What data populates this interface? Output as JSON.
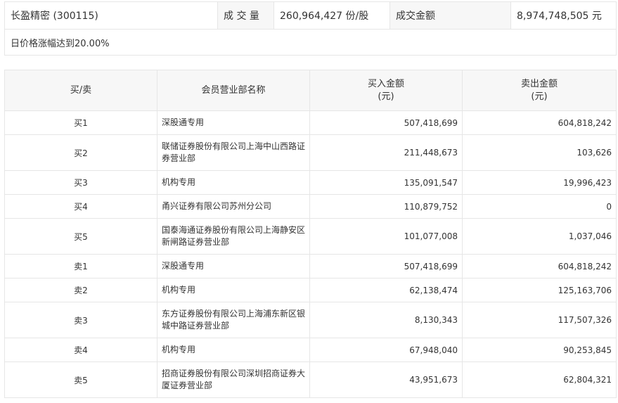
{
  "info": {
    "stock": "长盈精密 (300115)",
    "volume_label": "成 交 量",
    "volume_value": "260,964,427 份/股",
    "amount_label": "成交金额",
    "amount_value": "8,974,748,505 元",
    "reason": "日价格涨幅达到20.00%"
  },
  "table": {
    "headers": {
      "side": "买/卖",
      "dept": "会员营业部名称",
      "buy": "买入金额",
      "buy_unit": "(元)",
      "sell": "卖出金额",
      "sell_unit": "(元)"
    },
    "rows": [
      {
        "side": "买1",
        "name": "深股通专用",
        "buy": "507,418,699",
        "sell": "604,818,242"
      },
      {
        "side": "买2",
        "name": "联储证券股份有限公司上海中山西路证券营业部",
        "buy": "211,448,673",
        "sell": "103,626"
      },
      {
        "side": "买3",
        "name": "机构专用",
        "buy": "135,091,547",
        "sell": "19,996,423"
      },
      {
        "side": "买4",
        "name": "甬兴证券有限公司苏州分公司",
        "buy": "110,879,752",
        "sell": "0"
      },
      {
        "side": "买5",
        "name": "国泰海通证券股份有限公司上海静安区新闸路证券营业部",
        "buy": "101,077,008",
        "sell": "1,037,046"
      },
      {
        "side": "卖1",
        "name": "深股通专用",
        "buy": "507,418,699",
        "sell": "604,818,242"
      },
      {
        "side": "卖2",
        "name": "机构专用",
        "buy": "62,138,474",
        "sell": "125,163,706"
      },
      {
        "side": "卖3",
        "name": "东方证券股份有限公司上海浦东新区银城中路证券营业部",
        "buy": "8,130,343",
        "sell": "117,507,326"
      },
      {
        "side": "卖4",
        "name": "机构专用",
        "buy": "67,948,040",
        "sell": "90,253,845"
      },
      {
        "side": "卖5",
        "name": "招商证券股份有限公司深圳招商证券大厦证券营业部",
        "buy": "43,951,673",
        "sell": "62,804,321"
      }
    ]
  }
}
